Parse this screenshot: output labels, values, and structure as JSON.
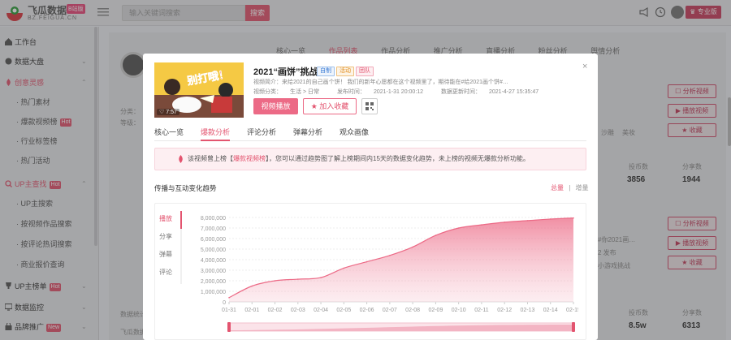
{
  "topbar": {
    "logo_name": "飞瓜数据",
    "logo_badge": "B站版",
    "logo_url": "BZ.FEIGUA.CN",
    "search_placeholder": "输入关键词搜索",
    "search_button": "搜索",
    "pro_button": "专业版"
  },
  "sidebar": {
    "items": [
      {
        "label": "工作台",
        "badge": ""
      },
      {
        "label": "数据大盘",
        "badge": ""
      },
      {
        "label": "创意灵感",
        "badge": ""
      },
      {
        "label": "热门素材",
        "badge": ""
      },
      {
        "label": "爆款视频榜",
        "badge": "Hot"
      },
      {
        "label": "行业标签榜",
        "badge": ""
      },
      {
        "label": "热门活动",
        "badge": ""
      },
      {
        "label": "UP主查找",
        "badge": "Hot"
      },
      {
        "label": "UP主搜索",
        "badge": ""
      },
      {
        "label": "按视频作品搜索",
        "badge": ""
      },
      {
        "label": "按评论热词搜索",
        "badge": ""
      },
      {
        "label": "商业报价查询",
        "badge": ""
      },
      {
        "label": "UP主榜单",
        "badge": "Hot"
      },
      {
        "label": "数据监控",
        "badge": ""
      },
      {
        "label": "品牌推广",
        "badge": "New"
      }
    ]
  },
  "background": {
    "tabs": [
      "核心一览",
      "作品列表",
      "作品分析",
      "推广分析",
      "直播分析",
      "粉丝分析",
      "舆情分析"
    ],
    "labels": {
      "fen_lei": "分类：",
      "deng_ji": "等级：",
      "tag1": "沙雕",
      "tag2": "美妆",
      "bottom_left": "飞瓜数据",
      "count_label1": "投币数",
      "count_label2": "分享数",
      "count_label3": "投币数",
      "count_label4": "分享数",
      "text1": "#你2021画…",
      "text2": "2 发布",
      "text3": "小游戏挑战",
      "data_note": "数据统计"
    },
    "buttons": {
      "analyze": "分析视频",
      "play": "播放视频",
      "collect": "收藏"
    },
    "numbers": {
      "coins1": "3856",
      "shares1": "1944",
      "coins2": "8.5w",
      "shares2": "6313"
    }
  },
  "modal": {
    "thumb_time": "7:57",
    "thumb_text": "别打哦！",
    "title": "2021“画饼”挑战",
    "tags": [
      "自制",
      "活动",
      "团队"
    ],
    "desc": "视频简介：来给2021的自己画个饼！ 我们的新年心愿都在这个视频里了，期待能在#给2021画个饼#…",
    "category_label": "视频分类：",
    "category_value": "生活 > 日常",
    "publish_label": "发布时间：",
    "publish_value": "2021-1-31 20:00:12",
    "update_label": "数据更新时间：",
    "update_value": "2021-4-27 15:35:47",
    "btn_play": "视频播放",
    "btn_fav": "加入收藏",
    "close": "×",
    "tabs": [
      "核心一览",
      "爆款分析",
      "评论分析",
      "弹幕分析",
      "观众画像"
    ],
    "notice_pre": "该视频曾上榜【",
    "notice_hl": "爆款视频榜",
    "notice_post": "】，您可以通过趋势图了解上榜期间内15天的数据变化趋势，未上榜的视频无爆款分析功能。",
    "chart_title": "传播与互动变化趋势",
    "toggle_total": "总量",
    "toggle_sep": "|",
    "toggle_incr": "增量",
    "metrics": [
      "播放",
      "分享",
      "弹幕",
      "评论"
    ]
  },
  "chart_data": {
    "type": "area",
    "series": [
      {
        "name": "播放",
        "values": [
          400000,
          1500000,
          2000000,
          2150000,
          2300000,
          3200000,
          3800000,
          4400000,
          5200000,
          6300000,
          7000000,
          7300000,
          7550000,
          7700000,
          7850000,
          7950000
        ]
      }
    ],
    "x": [
      "01-31",
      "02-01",
      "02-02",
      "02-03",
      "02-04",
      "02-05",
      "02-06",
      "02-07",
      "02-08",
      "02-09",
      "02-10",
      "02-11",
      "02-12",
      "02-13",
      "02-14",
      "02-15"
    ],
    "y_ticks": [
      "0",
      "1,000,000",
      "2,000,000",
      "3,000,000",
      "4,000,000",
      "5,000,000",
      "6,000,000",
      "7,000,000",
      "8,000,000"
    ],
    "ylim": [
      0,
      8000000
    ],
    "grid": true,
    "color": "#ec6a86"
  }
}
